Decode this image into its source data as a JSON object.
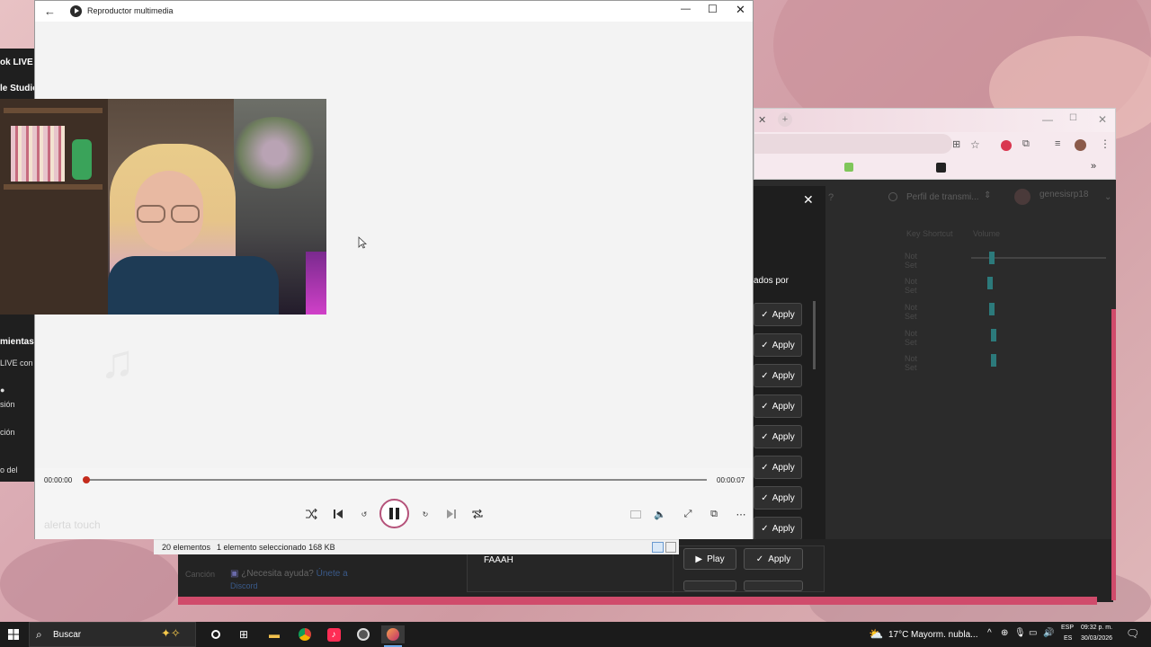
{
  "player": {
    "title": "Reproductor multimedia",
    "time_current": "00:00:00",
    "time_total": "00:00:07",
    "progress": 0.0,
    "track_overlay": "alerta touch"
  },
  "left_app": {
    "line1": "ok LIVE S",
    "line2": "le Studio",
    "line3": "mientas",
    "line4": "LIVE con",
    "line5": "sión",
    "line6": "ción",
    "line7": "o del"
  },
  "dark_app": {
    "profile_select": "Perfil de transmi...",
    "user_name": "genesisrp18",
    "sort_label": "ados por",
    "key_col": "Key Shortcut",
    "volume_col": "Volume",
    "not_set": "Not Set",
    "apply_label": "Apply",
    "play_label": "Play",
    "sound_name": "FAAAH"
  },
  "explorer": {
    "items_count": "20 elementos",
    "selection": "1 elemento seleccionado  168 KB",
    "hint_question": "¿Necesita ayuda?",
    "hint_link": "Únete a",
    "hint_link2": "Discord",
    "hint_label": "Canción"
  },
  "taskbar": {
    "search_placeholder": "Buscar",
    "weather_temp": "17°C",
    "weather_desc": "Mayorm. nubla...",
    "lang_top": "ESP",
    "lang_bottom": "ES",
    "time": "09:32 p. m.",
    "date": "30/03/2026"
  },
  "colors": {
    "accent": "#c42b1c",
    "pause_ring": "#b5527a",
    "dark_bg": "#2b2b2b",
    "pink_bar": "#d04b6b"
  }
}
